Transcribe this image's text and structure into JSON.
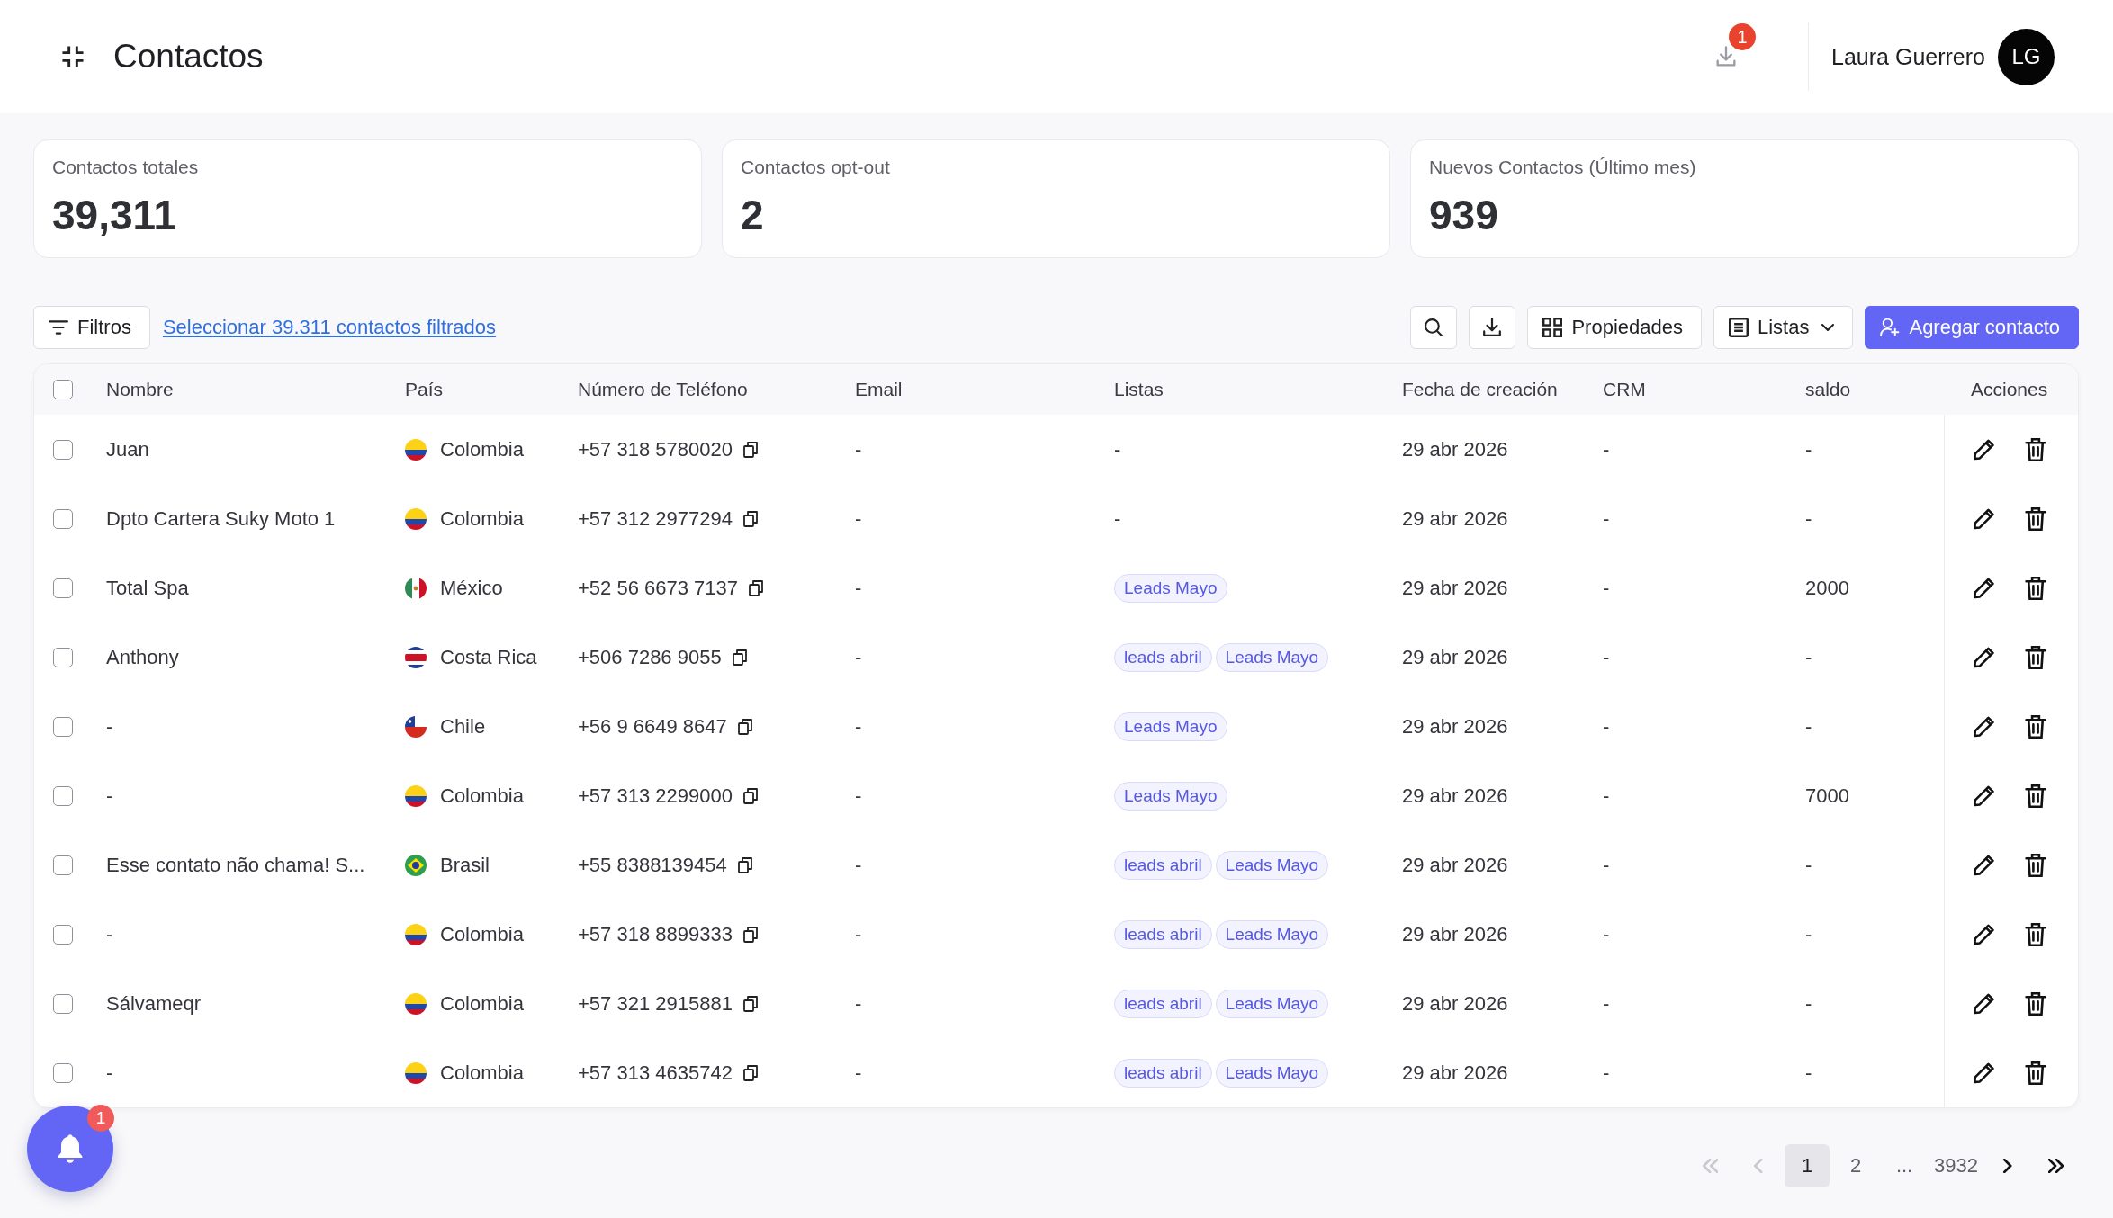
{
  "header": {
    "title": "Contactos",
    "downloads_badge": "1",
    "user_name": "Laura Guerrero",
    "user_initials": "LG"
  },
  "stats": [
    {
      "label": "Contactos totales",
      "value": "39,311"
    },
    {
      "label": "Contactos opt-out",
      "value": "2"
    },
    {
      "label": "Nuevos Contactos (Último mes)",
      "value": "939"
    }
  ],
  "toolbar": {
    "filters_button": "Filtros",
    "select_link": "Seleccionar 39.311 contactos filtrados",
    "properties_button": "Propiedades",
    "lists_button": "Listas",
    "add_button": "Agregar contacto"
  },
  "table": {
    "select_all_checked": false,
    "columns": [
      "Nombre",
      "País",
      "Número de Teléfono",
      "Email",
      "Listas",
      "Fecha de creación",
      "CRM",
      "saldo",
      "Acciones"
    ],
    "rows": [
      {
        "selected": false,
        "name": "Juan",
        "country": {
          "name": "Colombia",
          "kind": "co"
        },
        "phone": "+57 318 5780020",
        "email": "-",
        "lists": "-",
        "created": "29 abr 2026",
        "crm": "-",
        "saldo": "-"
      },
      {
        "selected": false,
        "name": "Dpto Cartera Suky Moto 1",
        "country": {
          "name": "Colombia",
          "kind": "co"
        },
        "phone": "+57 312 2977294",
        "email": "-",
        "lists": "-",
        "created": "29 abr 2026",
        "crm": "-",
        "saldo": "-"
      },
      {
        "selected": false,
        "name": "Total Spa",
        "country": {
          "name": "México",
          "kind": "mx"
        },
        "phone": "+52 56 6673 7137",
        "email": "-",
        "lists": [
          "Leads Mayo"
        ],
        "created": "29 abr 2026",
        "crm": "-",
        "saldo": "2000"
      },
      {
        "selected": false,
        "name": "Anthony",
        "country": {
          "name": "Costa Rica",
          "kind": "cr"
        },
        "phone": "+506 7286 9055",
        "email": "-",
        "lists": [
          "leads abril",
          "Leads Mayo"
        ],
        "created": "29 abr 2026",
        "crm": "-",
        "saldo": "-"
      },
      {
        "selected": false,
        "name": "-",
        "country": {
          "name": "Chile",
          "kind": "cl"
        },
        "phone": "+56 9 6649 8647",
        "email": "-",
        "lists": [
          "Leads Mayo"
        ],
        "created": "29 abr 2026",
        "crm": "-",
        "saldo": "-"
      },
      {
        "selected": false,
        "name": "-",
        "country": {
          "name": "Colombia",
          "kind": "co"
        },
        "phone": "+57 313 2299000",
        "email": "-",
        "lists": [
          "Leads Mayo"
        ],
        "created": "29 abr 2026",
        "crm": "-",
        "saldo": "7000"
      },
      {
        "selected": false,
        "name": "Esse contato não chama! S...",
        "country": {
          "name": "Brasil",
          "kind": "br"
        },
        "phone": "+55 8388139454",
        "email": "-",
        "lists": [
          "leads abril",
          "Leads Mayo"
        ],
        "created": "29 abr 2026",
        "crm": "-",
        "saldo": "-"
      },
      {
        "selected": false,
        "name": "-",
        "country": {
          "name": "Colombia",
          "kind": "co"
        },
        "phone": "+57 318 8899333",
        "email": "-",
        "lists": [
          "leads abril",
          "Leads Mayo"
        ],
        "created": "29 abr 2026",
        "crm": "-",
        "saldo": "-"
      },
      {
        "selected": false,
        "name": "Sálvameqr",
        "country": {
          "name": "Colombia",
          "kind": "co"
        },
        "phone": "+57 321 2915881",
        "email": "-",
        "lists": [
          "leads abril",
          "Leads Mayo"
        ],
        "created": "29 abr 2026",
        "crm": "-",
        "saldo": "-"
      },
      {
        "selected": false,
        "name": "-",
        "country": {
          "name": "Colombia",
          "kind": "co"
        },
        "phone": "+57 313 4635742",
        "email": "-",
        "lists": [
          "leads abril",
          "Leads Mayo"
        ],
        "created": "29 abr 2026",
        "crm": "-",
        "saldo": "-"
      }
    ]
  },
  "pagination": [
    {
      "kind": "first",
      "disabled": true
    },
    {
      "kind": "prev",
      "disabled": true
    },
    {
      "kind": "page",
      "label": "1",
      "selected": true
    },
    {
      "kind": "page",
      "label": "2",
      "selected": false
    },
    {
      "kind": "ellipsis",
      "label": "..."
    },
    {
      "kind": "page",
      "label": "3932",
      "selected": false
    },
    {
      "kind": "next",
      "disabled": false
    },
    {
      "kind": "last",
      "disabled": false
    }
  ],
  "notifications": {
    "badge": "1"
  }
}
